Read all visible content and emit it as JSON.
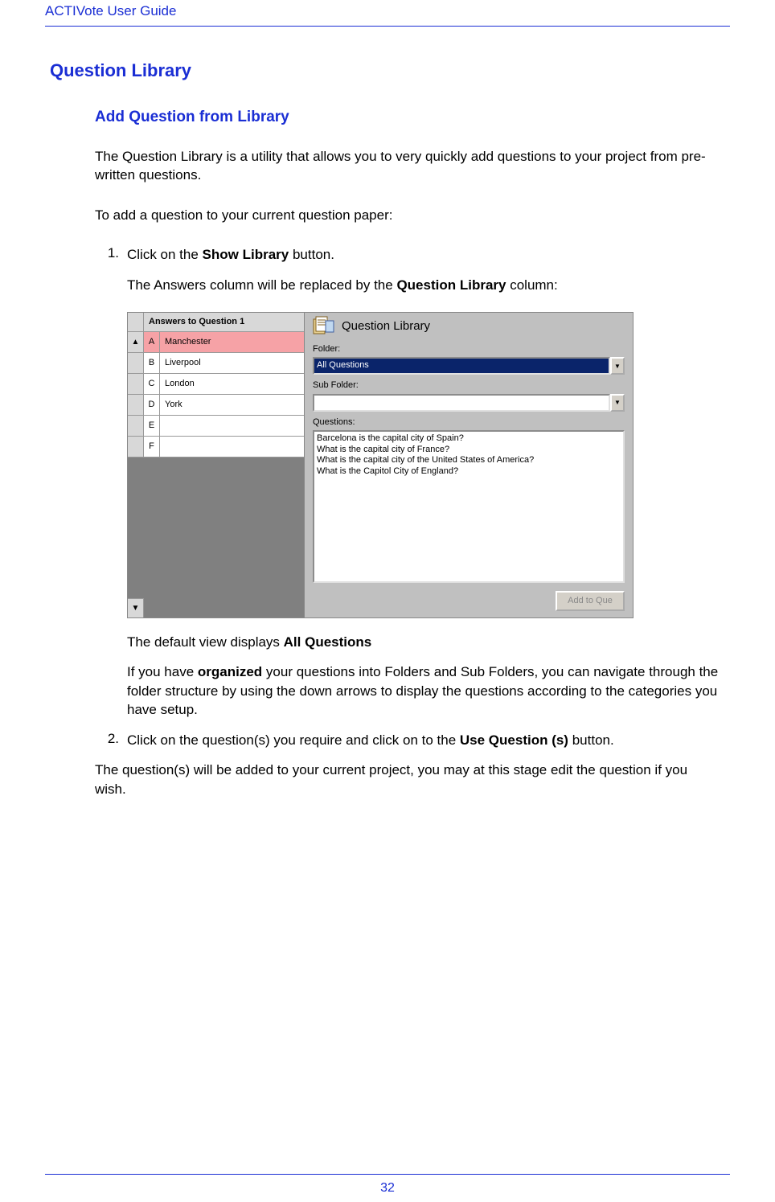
{
  "header": {
    "title": "ACTIVote User Guide"
  },
  "section": {
    "title": "Question Library",
    "subtitle": "Add Question from Library",
    "intro1": "The Question Library is a utility that allows you to very quickly add questions to your project from pre-written questions.",
    "intro2": "To add a question to your current question paper:"
  },
  "steps": {
    "one_num": "1.",
    "one_a": "Click on the ",
    "one_b_bold": "Show Library",
    "one_c": " button.",
    "one_sub_a": "The Answers column will be replaced by the ",
    "one_sub_bold": "Question Library",
    "one_sub_c": " column:",
    "after_img_a": "The default view displays ",
    "after_img_bold": "All Questions",
    "org_a": "If you have ",
    "org_bold": "organized",
    "org_b": " your questions into Folders and Sub Folders, you can navigate through the folder structure by using the down arrows to display the questions according to the categories you have setup.",
    "two_num": "2.",
    "two_a": "Click on the question(s) you require and click on to the ",
    "two_bold": "Use Question (s)",
    "two_c": " button."
  },
  "closing": "The question(s) will be added to your current project, you may at this stage edit the question if you wish.",
  "screenshot": {
    "answers_header": "Answers to Question 1",
    "up_arrow": "▲",
    "down_arrow": "▼",
    "rows": [
      {
        "letter": "A",
        "text": "Manchester",
        "hl": true
      },
      {
        "letter": "B",
        "text": "Liverpool",
        "hl": false
      },
      {
        "letter": "C",
        "text": "London",
        "hl": false
      },
      {
        "letter": "D",
        "text": "York",
        "hl": false
      },
      {
        "letter": "E",
        "text": "",
        "hl": false
      },
      {
        "letter": "F",
        "text": "",
        "hl": false
      }
    ],
    "lib_title": "Question Library",
    "folder_label": "Folder:",
    "folder_value": "All Questions",
    "subfolder_label": "Sub Folder:",
    "subfolder_value": "",
    "questions_label": "Questions:",
    "questions": [
      "Barcelona is the capital city of Spain?",
      "What is the capital city of France?",
      "What is the capital city of the United States of America?",
      "What is the Capitol City of England?"
    ],
    "add_button": "Add to Que",
    "combo_arrow": "▼"
  },
  "footer": {
    "page": "32"
  }
}
